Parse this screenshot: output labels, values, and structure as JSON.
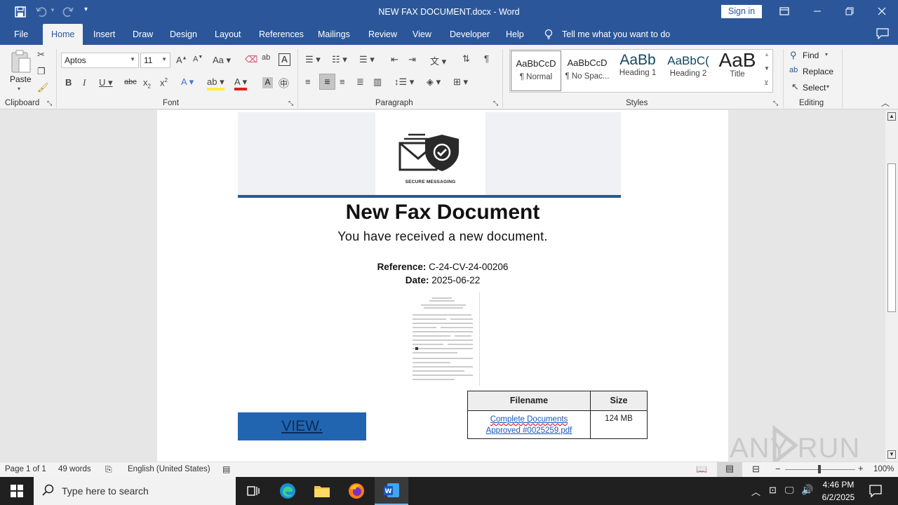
{
  "window": {
    "title": "NEW FAX DOCUMENT.docx  -  Word",
    "sign_in": "Sign in",
    "ribbon_display_icon": "ribbon-display-icon",
    "minimize_icon": "minimize-icon",
    "restore_icon": "restore-icon",
    "close_icon": "close-icon"
  },
  "qat": {
    "save_icon": "save-icon",
    "undo_icon": "undo-icon",
    "redo_icon": "redo-icon",
    "customize_icon": "chevron-down-icon"
  },
  "tabs": [
    {
      "label": "File"
    },
    {
      "label": "Home"
    },
    {
      "label": "Insert"
    },
    {
      "label": "Draw"
    },
    {
      "label": "Design"
    },
    {
      "label": "Layout"
    },
    {
      "label": "References"
    },
    {
      "label": "Mailings"
    },
    {
      "label": "Review"
    },
    {
      "label": "View"
    },
    {
      "label": "Developer"
    },
    {
      "label": "Help"
    }
  ],
  "tell_me": "Tell me what you want to do",
  "ribbon": {
    "clipboard": {
      "label": "Clipboard",
      "paste": "Paste"
    },
    "font": {
      "label": "Font",
      "name": "Aptos",
      "size": "11"
    },
    "paragraph": {
      "label": "Paragraph"
    },
    "styles": {
      "label": "Styles",
      "items": [
        {
          "preview": "AaBbCcD",
          "name": "¶ Normal"
        },
        {
          "preview": "AaBbCcD",
          "name": "¶ No Spac..."
        },
        {
          "preview": "AaBb",
          "name": "Heading 1"
        },
        {
          "preview": "AaBbC(",
          "name": "Heading 2"
        },
        {
          "preview": "AaB",
          "name": "Title"
        }
      ]
    },
    "editing": {
      "label": "Editing",
      "find": "Find",
      "replace": "Replace",
      "select": "Select"
    }
  },
  "document": {
    "logo_caption": "SECURE MESSAGING",
    "heading": "New Fax Document",
    "subheading": "You have received a new document.",
    "reference_label": "Reference:",
    "reference_value": "C-24-CV-24-00206",
    "date_label": "Date:",
    "date_value": "2025-06-22",
    "view_button": "VIEW.",
    "table": {
      "headers": [
        "Filename",
        "Size"
      ],
      "rows": [
        {
          "filename_line1": "Complete  Documents",
          "filename_line2": "Approved #0025259.pdf",
          "size": "124 MB"
        }
      ]
    },
    "watermark": "ANY RUN"
  },
  "statusbar": {
    "page": "Page 1 of 1",
    "words": "49 words",
    "language": "English (United States)",
    "zoom": "100%"
  },
  "taskbar": {
    "search_placeholder": "Type here to search",
    "time": "4:46 PM",
    "date": "6/2/2025"
  },
  "colors": {
    "word_blue": "#2b579a",
    "ribbon_bg": "#f3f3f3",
    "view_button": "#2165b1",
    "link": "#1a55b8"
  }
}
